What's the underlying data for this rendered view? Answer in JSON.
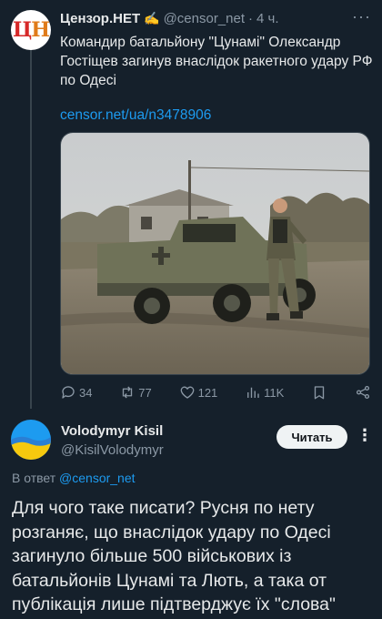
{
  "tweet": {
    "author_name": "Цензор.НЕТ",
    "author_emoji": "✍️",
    "handle": "@censor_net",
    "separator": "·",
    "time": "4 ч.",
    "more_label": "···",
    "avatar_text": {
      "first": "Ц",
      "second": "Н"
    },
    "text": "Командир батальйону \"Цунамі\" Олександр Гостіщев загинув внаслідок ракетного удару РФ по Одесі",
    "link": "censor.net/ua/n3478906",
    "stats": {
      "replies": "34",
      "retweets": "77",
      "likes": "121",
      "views": "11K"
    }
  },
  "reply": {
    "author_name": "Volodymyr Kisil",
    "handle": "@KisilVolodymyr",
    "follow_label": "Читать",
    "more_label": "⋮",
    "reply_to_prefix": "В ответ",
    "reply_to_mention": "@censor_net",
    "text": "Для чого таке писати? Русня по нету розганяє, що внаслідок удару по Одесі загинуло більше 500 військових із батальйонів Цунамі та Лють, а така от публікація лише підтверджує їх \"слова\""
  },
  "colors": {
    "background": "#15202b",
    "accent": "#1d9bf0",
    "muted": "#8b98a5",
    "text": "#e7e9ea"
  },
  "icons": [
    "reply-icon",
    "retweet-icon",
    "like-icon",
    "views-icon",
    "bookmark-icon",
    "share-icon"
  ]
}
